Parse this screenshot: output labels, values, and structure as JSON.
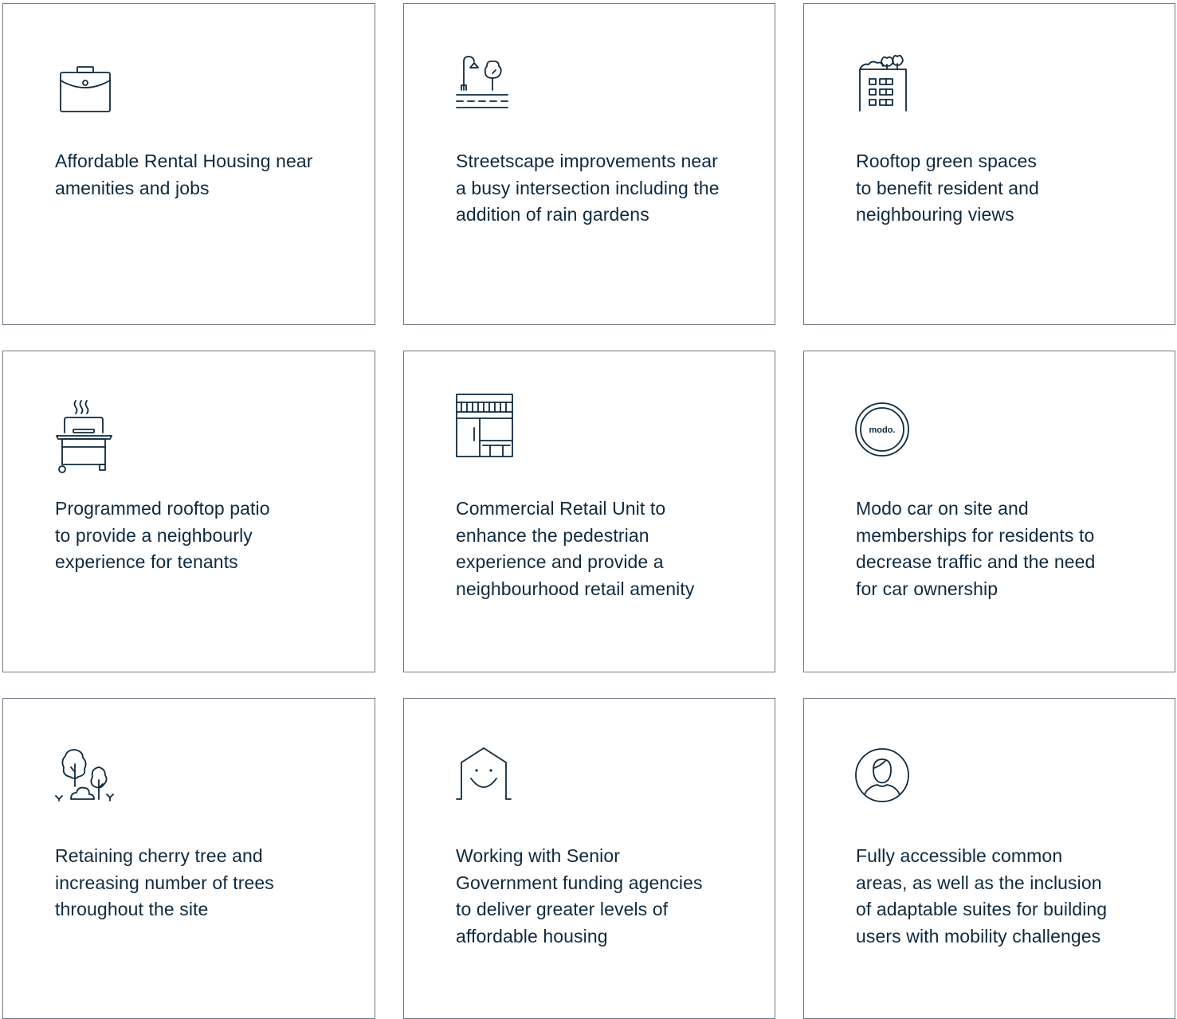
{
  "colors": {
    "text": "#0f2a3f",
    "border": "#6f7a85",
    "background": "#ffffff"
  },
  "cards": [
    {
      "icon": "briefcase-icon",
      "text": "Affordable Rental Housing near\namenities and jobs"
    },
    {
      "icon": "streetscape-icon",
      "text": "Streetscape improvements near\na busy intersection including the\naddition of rain gardens"
    },
    {
      "icon": "rooftop-garden-building-icon",
      "text": "Rooftop green spaces\nto benefit resident and\nneighbouring views"
    },
    {
      "icon": "bbq-grill-icon",
      "text": "Programmed rooftop patio\nto provide a neighbourly\nexperience for tenants"
    },
    {
      "icon": "storefront-icon",
      "text": "Commercial Retail Unit to\nenhance the pedestrian\nexperience and provide a\nneighbourhood retail amenity"
    },
    {
      "icon": "modo-logo-icon",
      "logo_text": "modo.",
      "text": "Modo car on site and\nmemberships for residents to\ndecrease traffic and the need\nfor car ownership"
    },
    {
      "icon": "trees-icon",
      "text": "Retaining cherry tree and\nincreasing number of trees\nthroughout the site"
    },
    {
      "icon": "smiling-house-icon",
      "text": "Working with Senior\nGovernment funding agencies\nto deliver greater levels of\naffordable housing"
    },
    {
      "icon": "person-icon",
      "text": "Fully accessible common\nareas, as well as the inclusion\nof adaptable suites for building\nusers with mobility challenges"
    }
  ]
}
